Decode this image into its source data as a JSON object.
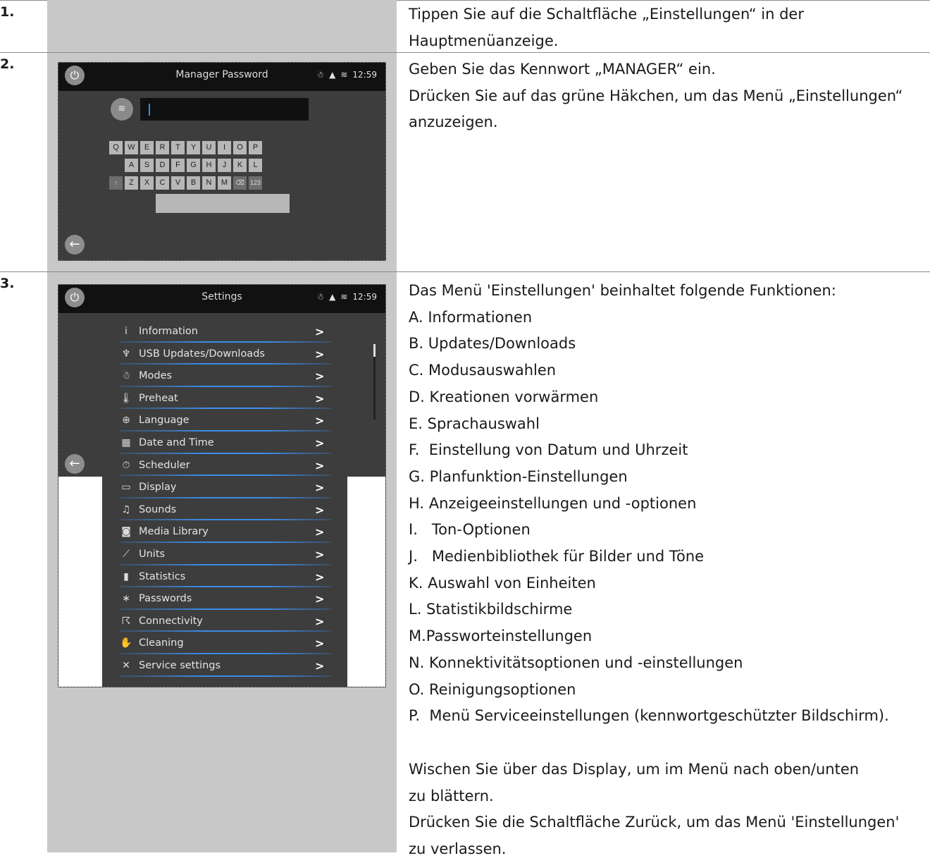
{
  "steps": [
    {
      "number": "1.",
      "lines": [
        "Tippen Sie auf die Schaltfläche „Einstellungen“ in der",
        "Hauptmenüanzeige."
      ]
    },
    {
      "number": "2.",
      "lines": [
        "Geben Sie das Kennwort „MANAGER“ ein.",
        "Drücken Sie auf das grüne Häkchen, um das Menü „Einstellungen“",
        "anzuzeigen."
      ]
    },
    {
      "number": "3.",
      "intro": "Das Menü 'Einstellungen' beinhaltet folgende Funktionen:",
      "items": [
        "A. Informationen",
        "B. Updates/Downloads",
        "C. Modusauswahlen",
        "D. Kreationen vorwärmen",
        "E. Sprachauswahl",
        "F.  Einstellung von Datum und Uhrzeit",
        "G. Planfunktion-Einstellungen",
        "H. Anzeigeeinstellungen und -optionen",
        "I.   Ton-Optionen",
        "J.   Medienbibliothek für Bilder und Töne",
        "K. Auswahl von Einheiten",
        "L. Statistikbildschirme",
        "M.Passworteinstellungen",
        "N. Konnektivitätsoptionen und -einstellungen",
        "O. Reinigungsoptionen",
        "P.  Menü Serviceeinstellungen (kennwortgeschützter Bildschirm)."
      ],
      "outro": [
        "Wischen Sie über das Display, um im Menü nach oben/unten",
        "zu blättern.",
        "Drücken Sie die Schaltfläche Zurück, um das Menü 'Einstellungen'",
        "zu verlassen."
      ]
    }
  ],
  "password_screen": {
    "title": "Manager Password",
    "time": "12:59",
    "keys_row1": [
      "Q",
      "W",
      "E",
      "R",
      "T",
      "Y",
      "U",
      "I",
      "O",
      "P"
    ],
    "keys_row2": [
      "A",
      "S",
      "D",
      "F",
      "G",
      "H",
      "J",
      "K",
      "L"
    ],
    "keys_row3": [
      "↑",
      "Z",
      "X",
      "C",
      "V",
      "B",
      "N",
      "M",
      "⌫",
      "123"
    ]
  },
  "settings_screen": {
    "title": "Settings",
    "time": "12:59",
    "menu": [
      {
        "icon": "i",
        "label": "Information"
      },
      {
        "icon": "♆",
        "label": "USB Updates/Downloads"
      },
      {
        "icon": "☃",
        "label": "Modes"
      },
      {
        "icon": "🌡",
        "label": "Preheat"
      },
      {
        "icon": "⊕",
        "label": "Language"
      },
      {
        "icon": "▦",
        "label": "Date and Time"
      },
      {
        "icon": "⏱",
        "label": "Scheduler"
      },
      {
        "icon": "▭",
        "label": "Display"
      },
      {
        "icon": "♫",
        "label": "Sounds"
      },
      {
        "icon": "◙",
        "label": "Media Library"
      },
      {
        "icon": "⟋",
        "label": "Units"
      },
      {
        "icon": "▮",
        "label": "Statistics"
      },
      {
        "icon": "∗",
        "label": "Passwords"
      },
      {
        "icon": "☈",
        "label": "Connectivity"
      },
      {
        "icon": "✋",
        "label": "Cleaning"
      },
      {
        "icon": "✕",
        "label": "Service settings"
      }
    ]
  },
  "colors": {
    "panel": "#c8c8c8",
    "accent_line": "#3c8ce6",
    "screen_bg": "#3d3d3d"
  }
}
